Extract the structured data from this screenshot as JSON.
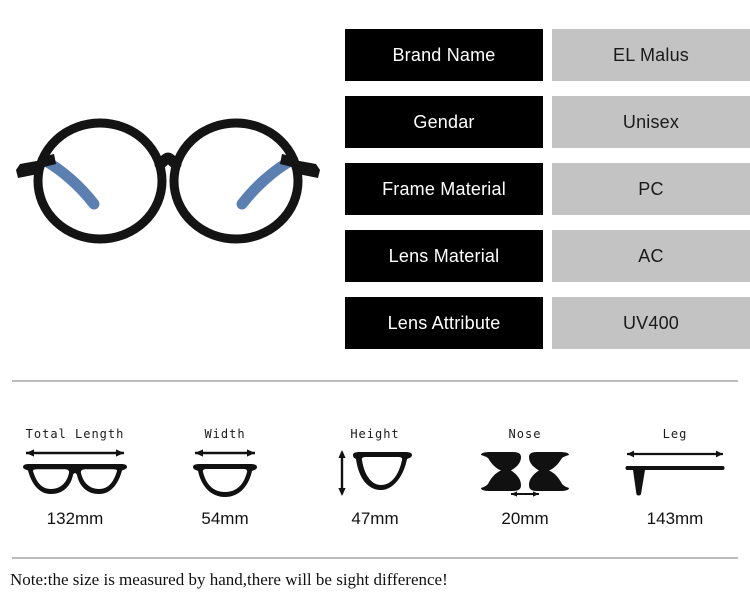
{
  "product": {
    "photo_alt": "round black eyeglasses front view",
    "frame_color": "#141414",
    "temple_color": "#5b7fb0"
  },
  "spec_table": {
    "rows": [
      {
        "key": "Brand Name",
        "value": "EL Malus"
      },
      {
        "key": "Gendar",
        "value": "Unisex"
      },
      {
        "key": "Frame Material",
        "value": "PC"
      },
      {
        "key": "Lens Material",
        "value": "AC"
      },
      {
        "key": "Lens Attribute",
        "value": "UV400"
      }
    ],
    "key_bg": "#000000",
    "key_color": "#ffffff",
    "value_bg": "#c3c3c3",
    "value_color": "#1a1a1a"
  },
  "measurements": [
    {
      "label": "Total Length",
      "value": "132mm",
      "icon": "glasses-full-icon",
      "arrow": "horizontal"
    },
    {
      "label": "Width",
      "value": "54mm",
      "icon": "lens-width-icon",
      "arrow": "horizontal"
    },
    {
      "label": "Height",
      "value": "47mm",
      "icon": "lens-height-icon",
      "arrow": "vertical"
    },
    {
      "label": "Nose",
      "value": "20mm",
      "icon": "nose-bridge-icon",
      "arrow": "horizontal"
    },
    {
      "label": "Leg",
      "value": "143mm",
      "icon": "temple-leg-icon",
      "arrow": "horizontal"
    }
  ],
  "note": "Note:the size is measured by hand,there will be sight difference!",
  "divider_color": "#bdbdbd"
}
